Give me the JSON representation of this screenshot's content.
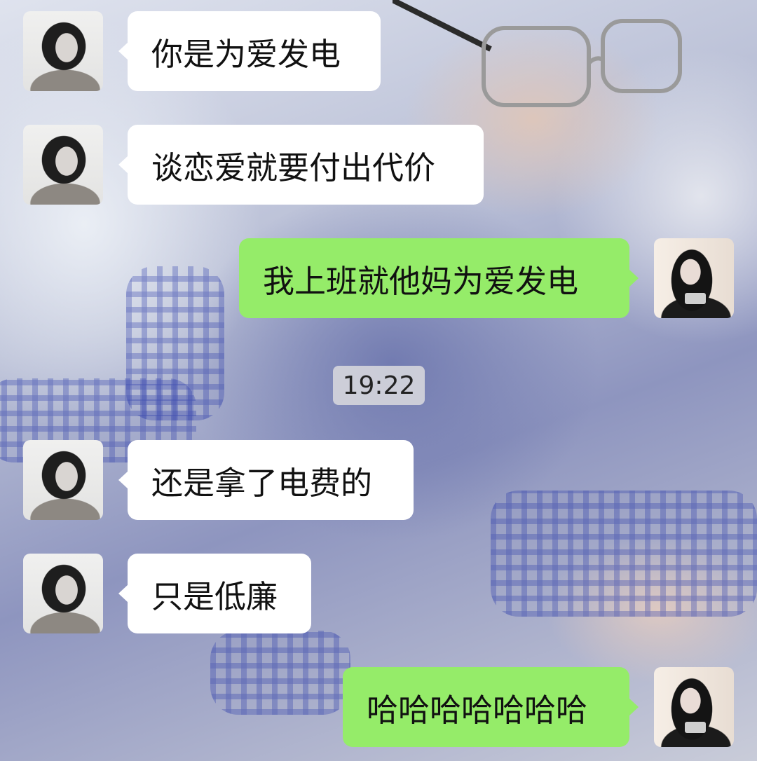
{
  "chat": {
    "messages": [
      {
        "sender": "other",
        "text": "你是为爱发电"
      },
      {
        "sender": "other",
        "text": "谈恋爱就要付出代价"
      },
      {
        "sender": "self",
        "text": "我上班就他妈为爱发电"
      },
      {
        "sender": "other",
        "text": "还是拿了电费的"
      },
      {
        "sender": "other",
        "text": "只是低廉"
      },
      {
        "sender": "self",
        "text": "哈哈哈哈哈哈哈"
      }
    ],
    "timestamp": "19:22",
    "colors": {
      "self_bubble": "#95ec69",
      "other_bubble": "#ffffff",
      "timestamp_bg": "#dadade"
    }
  }
}
